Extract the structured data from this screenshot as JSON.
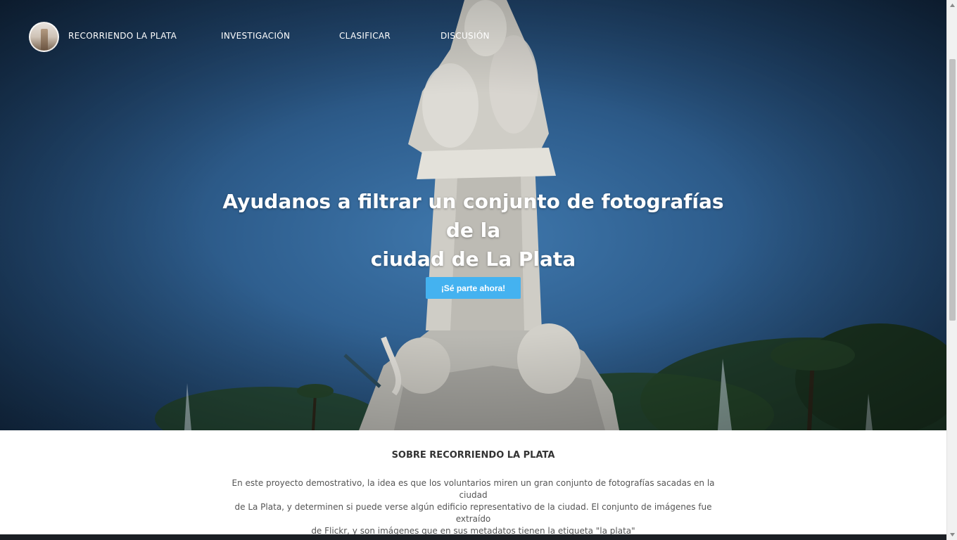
{
  "nav": {
    "brand": "RECORRIENDO LA PLATA",
    "links": [
      "INVESTIGACIÓN",
      "CLASIFICAR",
      "DISCUSIÓN"
    ]
  },
  "hero": {
    "title_line1": "Ayudanos a filtrar un conjunto de fotografías de la",
    "title_line2": "ciudad de La Plata",
    "cta_label": "¡Sé parte ahora!"
  },
  "about": {
    "title": "SOBRE RECORRIENDO LA PLATA",
    "text_line1": "En este proyecto demostrativo, la idea es que los voluntarios miren un gran conjunto de fotografías sacadas en la ciudad",
    "text_line2": "de La Plata, y determinen si puede verse algún edificio representativo de la ciudad. El conjunto de imágenes fue extraído",
    "text_line3": "de Flickr, y son imágenes que en sus metadatos tienen la etiqueta \"la plata\""
  },
  "colors": {
    "cta": "#44b2f0",
    "hero_sky": "#2f5f8f",
    "text_dark": "#333333"
  },
  "icons": {
    "logo": "project-logo-avatar",
    "scroll_up": "arrow-up-icon",
    "scroll_down": "arrow-down-icon"
  }
}
